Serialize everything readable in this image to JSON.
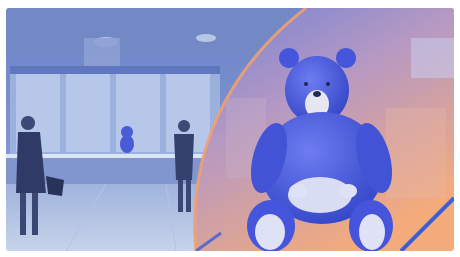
{
  "scene": {
    "description_icons": [
      "bank-hall-photo",
      "blue-bear-mascot"
    ],
    "colors": {
      "left_tint": "#5d74b8",
      "right_gradient_top": "#6a7fd0",
      "right_gradient_bottom": "#f0a57a",
      "accent_band": "#3d5fd6",
      "bear_body": "#4b5ce0",
      "bear_belly": "#d8dcf3"
    }
  }
}
